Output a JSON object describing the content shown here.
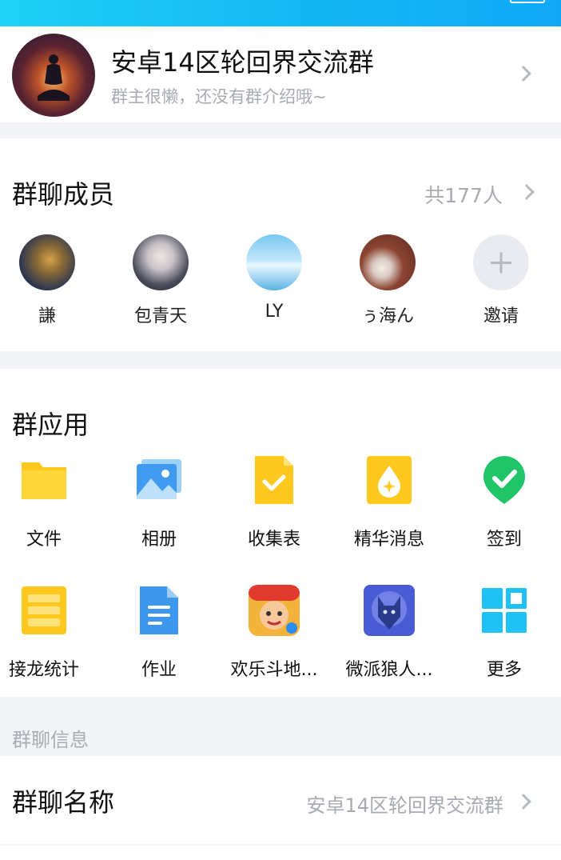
{
  "group": {
    "name": "安卓14区轮回界交流群",
    "description": "群主很懒，还没有群介绍哦~"
  },
  "members": {
    "title": "群聊成员",
    "count": "共177人",
    "list": [
      {
        "name": "謙"
      },
      {
        "name": "包青天"
      },
      {
        "name": "LY"
      },
      {
        "name": "ぅ海ん"
      }
    ],
    "invite_label": "邀请"
  },
  "apps": {
    "title": "群应用",
    "items": [
      {
        "label": "文件",
        "icon": "folder-icon"
      },
      {
        "label": "相册",
        "icon": "album-icon"
      },
      {
        "label": "收集表",
        "icon": "collect-form-icon"
      },
      {
        "label": "精华消息",
        "icon": "essence-icon"
      },
      {
        "label": "签到",
        "icon": "checkin-icon"
      },
      {
        "label": "接龙统计",
        "icon": "relay-icon"
      },
      {
        "label": "作业",
        "icon": "homework-icon"
      },
      {
        "label": "欢乐斗地...",
        "icon": "game-doudizhu-icon"
      },
      {
        "label": "微派狼人...",
        "icon": "game-werewolf-icon"
      },
      {
        "label": "更多",
        "icon": "more-grid-icon"
      }
    ]
  },
  "info": {
    "section_label": "群聊信息",
    "name_title": "群聊名称",
    "name_value": "安卓14区轮回界交流群"
  },
  "colors": {
    "accent": "#12b8f5",
    "background": "#f3f4f7",
    "secondary_text": "#a7aab1"
  }
}
